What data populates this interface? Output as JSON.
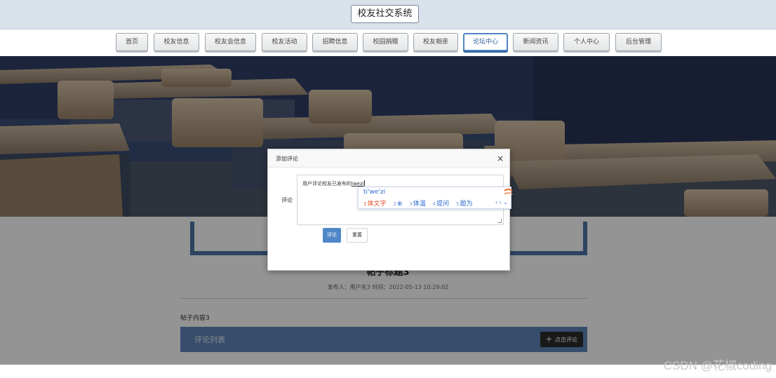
{
  "header": {
    "site_title": "校友社交系统"
  },
  "nav": {
    "items": [
      {
        "label": "首页"
      },
      {
        "label": "校友信息"
      },
      {
        "label": "校友会信息"
      },
      {
        "label": "校友活动"
      },
      {
        "label": "招聘信息"
      },
      {
        "label": "校园捐赠"
      },
      {
        "label": "校友相亲"
      },
      {
        "label": "论坛中心"
      },
      {
        "label": "新闻资讯"
      },
      {
        "label": "个人中心"
      },
      {
        "label": "后台管理"
      }
    ],
    "active_index": 7
  },
  "post": {
    "title": "帖子标题3",
    "meta": "发布人：用户名3 时间：2022-05-13 10:29:02",
    "content": "帖子内容3",
    "comment_list_label": "评论列表",
    "add_comment_label": "点击评论"
  },
  "modal": {
    "title": "添加评论",
    "close": "×",
    "field_label": "评论",
    "textarea_value": "用户评论校友已发布的",
    "textarea_composing": "iwezi",
    "submit_label": "评论",
    "reset_label": "重置"
  },
  "ime": {
    "pinyin": "ti'we'zi",
    "candidates": [
      {
        "n": "1",
        "text": "体文字"
      },
      {
        "n": "2",
        "text": "⊕"
      },
      {
        "n": "3",
        "text": "体温"
      },
      {
        "n": "4",
        "text": "提问"
      },
      {
        "n": "5",
        "text": "题为"
      }
    ],
    "arrows": "‹ › ⌄"
  },
  "watermark": "CSDN @花椒coding",
  "colors": {
    "accent": "#4e75a5",
    "comment_bar": "#5d87b8",
    "submit_button": "#4e86c7",
    "ime_highlight": "#e8542c"
  }
}
